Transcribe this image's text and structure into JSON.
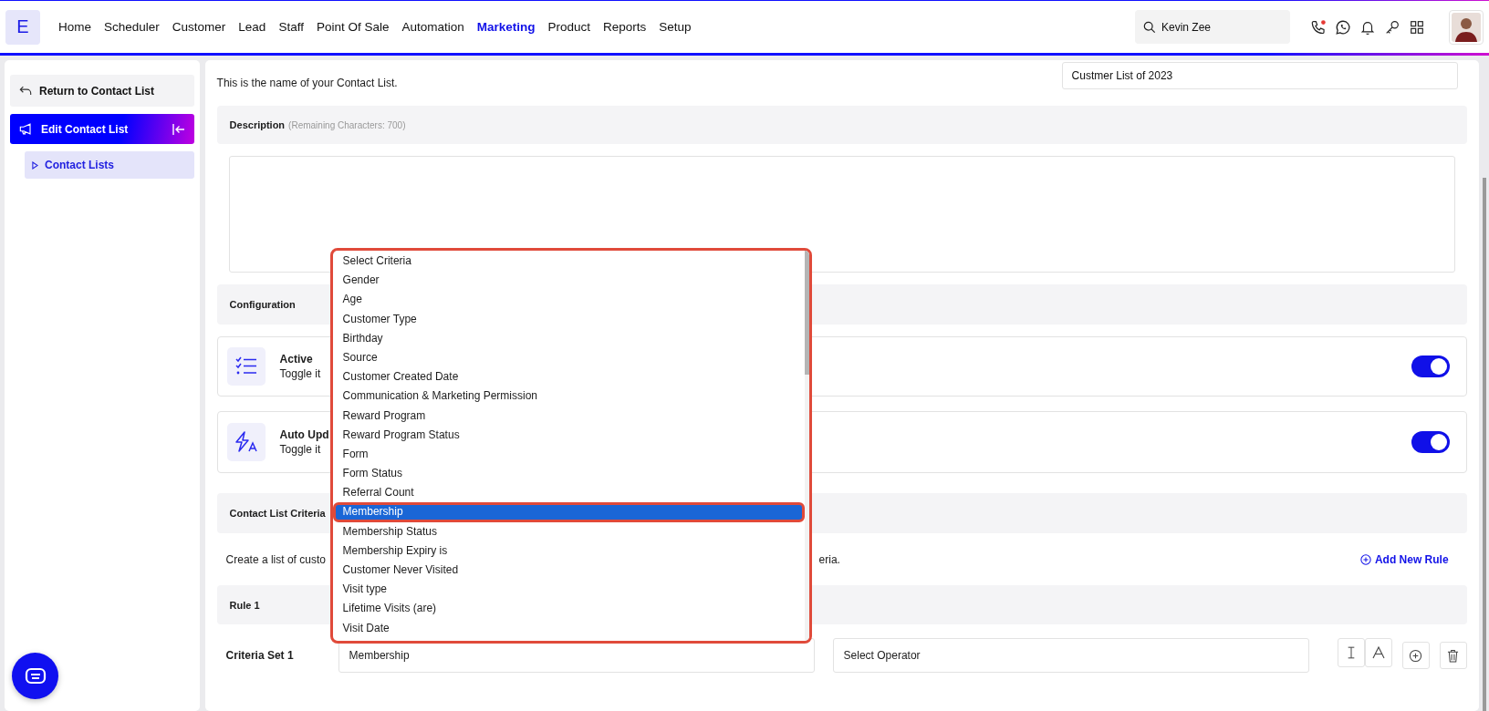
{
  "nav": {
    "logo": "E",
    "items": [
      {
        "label": "Home",
        "selected": false
      },
      {
        "label": "Scheduler",
        "selected": false
      },
      {
        "label": "Customer",
        "selected": false
      },
      {
        "label": "Lead",
        "selected": false
      },
      {
        "label": "Staff",
        "selected": false
      },
      {
        "label": "Point Of Sale",
        "selected": false
      },
      {
        "label": "Automation",
        "selected": false
      },
      {
        "label": "Marketing",
        "selected": true
      },
      {
        "label": "Product",
        "selected": false
      },
      {
        "label": "Reports",
        "selected": false
      },
      {
        "label": "Setup",
        "selected": false
      }
    ],
    "search": {
      "value": "Kevin Zee"
    }
  },
  "sidebar": {
    "back": "Return to Contact List",
    "section": "Edit Contact List",
    "items": [
      {
        "label": "Contact Lists",
        "selected": true
      }
    ]
  },
  "name_field": {
    "hint": "This is the name of your Contact List.",
    "value": "Custmer List of 2023"
  },
  "description": {
    "title": "Description",
    "remaining": "(Remaining Characters: 700)"
  },
  "configuration": {
    "title": "Configuration",
    "settings": [
      {
        "kind": "checklist",
        "title": "Active",
        "hint": "Toggle it",
        "on": true
      },
      {
        "kind": "automation",
        "title": "Auto Upd",
        "hint": "Toggle it",
        "on": true
      }
    ]
  },
  "criteria": {
    "title": "Contact List Criteria",
    "intro_start": "Create a list of custo",
    "intro_end": "eria.",
    "add_button": "Add New Rule"
  },
  "rule": {
    "title": "Rule 1",
    "set_label": "Criteria Set 1",
    "criteria_value": "Membership",
    "operator": "Select Operator"
  },
  "dropdown": {
    "options": [
      {
        "label": "Select Criteria",
        "selected": false
      },
      {
        "label": "Gender",
        "selected": false
      },
      {
        "label": "Age",
        "selected": false
      },
      {
        "label": "Customer Type",
        "selected": false
      },
      {
        "label": "Birthday",
        "selected": false
      },
      {
        "label": "Source",
        "selected": false
      },
      {
        "label": "Customer Created Date",
        "selected": false
      },
      {
        "label": "Communication & Marketing Permission",
        "selected": false
      },
      {
        "label": "Reward Program",
        "selected": false
      },
      {
        "label": "Reward Program Status",
        "selected": false
      },
      {
        "label": "Form",
        "selected": false
      },
      {
        "label": "Form Status",
        "selected": false
      },
      {
        "label": "Referral Count",
        "selected": false
      },
      {
        "label": "Membership",
        "selected": true
      },
      {
        "label": "Membership Status",
        "selected": false
      },
      {
        "label": "Membership Expiry is",
        "selected": false
      },
      {
        "label": "Customer Never Visited",
        "selected": false
      },
      {
        "label": "Visit type",
        "selected": false
      },
      {
        "label": "Lifetime Visits (are)",
        "selected": false
      },
      {
        "label": "Visit Date",
        "selected": false
      }
    ]
  }
}
